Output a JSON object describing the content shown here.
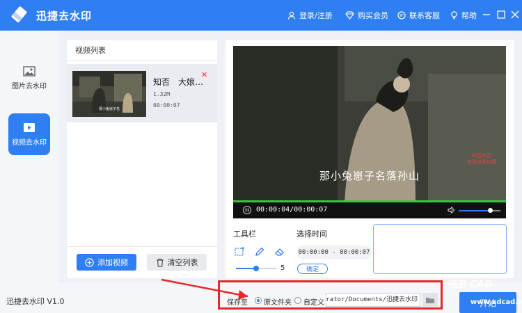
{
  "app": {
    "title": "迅捷去水印",
    "version": "迅捷去水印 V1.0"
  },
  "header": {
    "login": "登录/注册",
    "buy": "购买会员",
    "support": "联系客服",
    "help": "帮助"
  },
  "nav": {
    "items": [
      {
        "label": "图片去水印",
        "icon": "image-icon"
      },
      {
        "label": "视频去水印",
        "icon": "video-icon"
      }
    ]
  },
  "video_list": {
    "title": "视频列表",
    "items": [
      {
        "name": "知否　大娘…",
        "size": "1.32M",
        "duration": "00:00:07"
      }
    ],
    "add_label": "添加视频",
    "clear_label": "清空列表"
  },
  "player": {
    "subtitle": "那小兔崽子名落孙山",
    "time": "00:00:04/00:00:07",
    "progress": 1.0,
    "volume": 0.75
  },
  "tools": {
    "title": "工具栏",
    "brush_size": "5",
    "brush_level": 0.5,
    "time_title": "选择时间",
    "time_range": "00:00:00 - 00:00:07",
    "confirm": "确定"
  },
  "footer": {
    "save_label": "保存至",
    "option_original": "原文件夹",
    "option_custom": "自定义",
    "path": "C:/Users/Administrator/Documents/迅捷去水印",
    "start": "开始"
  },
  "colors": {
    "primary": "#2f7ff2",
    "annotation": "#e8262b",
    "progress": "#2ecc40"
  }
}
